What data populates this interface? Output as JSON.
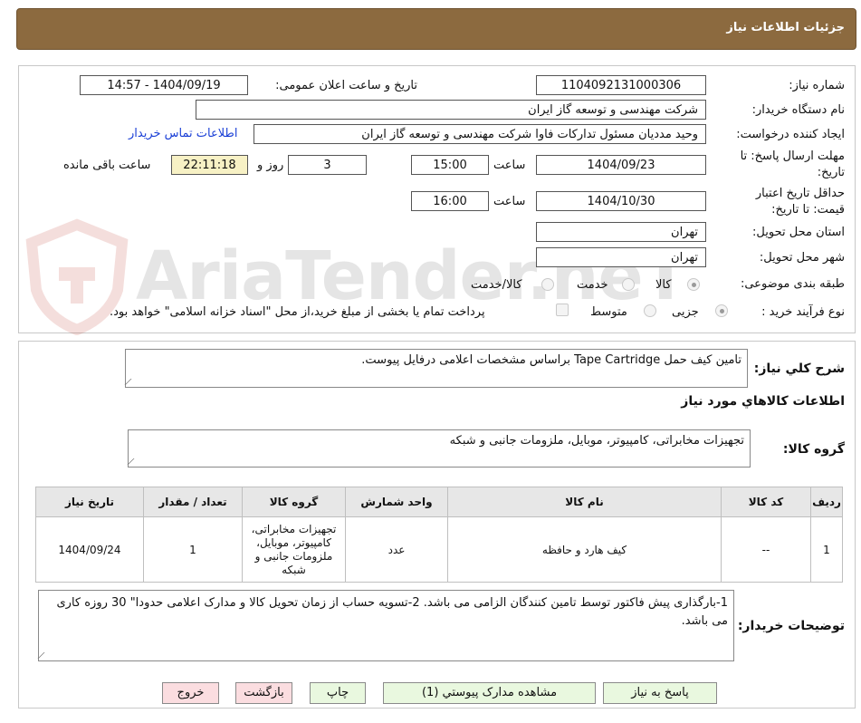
{
  "header": {
    "title": "جزئیات اطلاعات نیاز"
  },
  "details": {
    "need_number_label": "شماره نیاز:",
    "need_number": "1104092131000306",
    "announce_label": "تاریخ و ساعت اعلان عمومی:",
    "announce_value": "1404/09/19 - 14:57",
    "buyer_org_label": "نام دستگاه خریدار:",
    "buyer_org": "شرکت مهندسی و توسعه گاز ایران",
    "requester_label": "ایجاد کننده درخواست:",
    "requester": "وحید مددیان مسئول تدارکات فاوا شرکت مهندسی و توسعه گاز ایران",
    "contact_link": "اطلاعات تماس خریدار",
    "deadline_label_1": "مهلت ارسال پاسخ: تا",
    "deadline_label_2": "تاریخ:",
    "deadline_date": "1404/09/23",
    "time_label": "ساعت",
    "deadline_time": "15:00",
    "days_value": "3",
    "days_label": "روز و",
    "remaining_time": "22:11:18",
    "remaining_label": "ساعت باقی مانده",
    "validity_label_1": "حداقل تاریخ اعتبار",
    "validity_label_2": "قیمت: تا تاریخ:",
    "validity_date": "1404/10/30",
    "validity_time_label": "ساعت",
    "validity_time": "16:00",
    "province_label": "استان محل تحویل:",
    "province": "تهران",
    "city_label": "شهر محل تحویل:",
    "city": "تهران",
    "category_label": "طبقه بندی موضوعی:",
    "category_options": [
      "کالا",
      "خدمت",
      "کالا/خدمت"
    ],
    "process_label": "نوع فرآیند خرید :",
    "process_options": [
      "جزیی",
      "متوسط"
    ],
    "payment_note": "پرداخت تمام یا بخشی از مبلغ خرید،از محل \"اسناد خزانه اسلامی\" خواهد بود."
  },
  "watermark": {
    "text": "AriaTender.neT"
  },
  "description": {
    "label": "شرح کلي نياز:",
    "text": "تامین کیف حمل Tape Cartridge  براساس مشخصات اعلامی درفایل پیوست."
  },
  "goods": {
    "section_title": "اطلاعات کالاهاي مورد نياز",
    "group_label": "گروه کالا:",
    "group_value": "تجهیزات مخابراتی، کامپیوتر، موبایل، ملزومات جانبی و شبکه"
  },
  "table": {
    "headers": [
      "ردیف",
      "کد کالا",
      "نام کالا",
      "واحد شمارش",
      "گروه کالا",
      "تعداد / مقدار",
      "تاریخ نیاز"
    ],
    "rows": [
      {
        "row": "1",
        "code": "--",
        "name": "کیف هارد و حافظه",
        "unit": "عدد",
        "group": "تجهیزات مخابراتی، کامپیوتر، موبایل، ملزومات جانبی و شبکه",
        "qty": "1",
        "date": "1404/09/24"
      }
    ]
  },
  "buyer_notes": {
    "label": "توضیحات خریدار:",
    "text": "1-بارگذاری پیش فاکتور توسط تامین کنندگان الزامی می باشد.  2-تسویه حساب  از زمان تحویل کالا و مدارک اعلامی حدودا\" 30 روزه کاری می باشد."
  },
  "buttons": {
    "reply": "پاسخ به نیاز",
    "attachments": "مشاهده مدارک پیوستي (1)",
    "print": "چاپ",
    "back": "بازگشت",
    "exit": "خروج"
  }
}
